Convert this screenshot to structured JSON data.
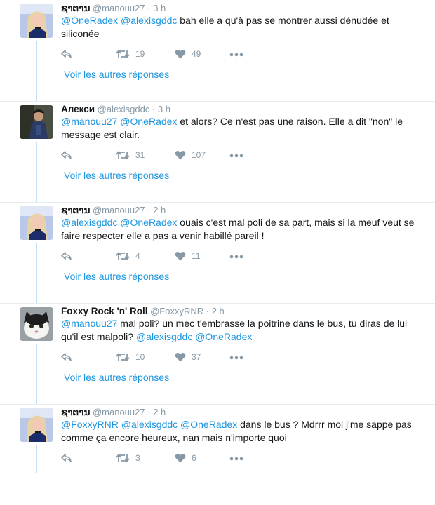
{
  "tweets": [
    {
      "name": "ຊາຕານ",
      "handle": "@manouu27",
      "time": "3 h",
      "body": [
        {
          "t": "@OneRadex",
          "m": true
        },
        {
          "t": " ",
          "m": false
        },
        {
          "t": "@alexisgddc",
          "m": true
        },
        {
          "t": " bah elle a qu'à pas se montrer aussi dénudée et siliconée",
          "m": false
        }
      ],
      "retweets": "19",
      "likes": "49",
      "more_label": "Voir les autres réponses",
      "avatar": "girl-selfie"
    },
    {
      "name": "Алекси",
      "handle": "@alexisgddc",
      "time": "3 h",
      "body": [
        {
          "t": "@manouu27",
          "m": true
        },
        {
          "t": " ",
          "m": false
        },
        {
          "t": "@OneRadex",
          "m": true
        },
        {
          "t": " et alors? Ce n'est pas une raison. Elle a dit \"non\" le message est clair.",
          "m": false
        }
      ],
      "retweets": "31",
      "likes": "107",
      "more_label": "Voir les autres réponses",
      "avatar": "man-dark"
    },
    {
      "name": "ຊາຕານ",
      "handle": "@manouu27",
      "time": "2 h",
      "body": [
        {
          "t": "@alexisgddc",
          "m": true
        },
        {
          "t": " ",
          "m": false
        },
        {
          "t": "@OneRadex",
          "m": true
        },
        {
          "t": " ouais c'est mal poli de sa part, mais si la meuf  veut se faire respecter elle a pas a venir habillé pareil !",
          "m": false
        }
      ],
      "retweets": "4",
      "likes": "11",
      "more_label": "Voir les autres réponses",
      "avatar": "girl-selfie"
    },
    {
      "name": "Foxxy Rock 'n' Roll",
      "handle": "@FoxxyRNR",
      "time": "2 h",
      "body": [
        {
          "t": "@manouu27",
          "m": true
        },
        {
          "t": " mal poli? un mec t'embrasse la poitrine dans le bus, tu diras de lui qu'il est malpoli? ",
          "m": false
        },
        {
          "t": "@alexisgddc",
          "m": true
        },
        {
          "t": " ",
          "m": false
        },
        {
          "t": "@OneRadex",
          "m": true
        }
      ],
      "retweets": "10",
      "likes": "37",
      "more_label": "Voir les autres réponses",
      "avatar": "cat"
    },
    {
      "name": "ຊາຕານ",
      "handle": "@manouu27",
      "time": "2 h",
      "body": [
        {
          "t": "@FoxxyRNR",
          "m": true
        },
        {
          "t": " ",
          "m": false
        },
        {
          "t": "@alexisgddc",
          "m": true
        },
        {
          "t": " ",
          "m": false
        },
        {
          "t": "@OneRadex",
          "m": true
        },
        {
          "t": "  dans le bus ? Mdrrr moi j'me sappe pas comme ça encore heureux, nan mais n'importe quoi",
          "m": false
        }
      ],
      "retweets": "3",
      "likes": "6",
      "more_label": "",
      "avatar": "girl-selfie"
    }
  ],
  "colors": {
    "link": "#1b95e0",
    "meta": "#8899a6",
    "text": "#14171a",
    "thread": "#c4e0f4"
  }
}
